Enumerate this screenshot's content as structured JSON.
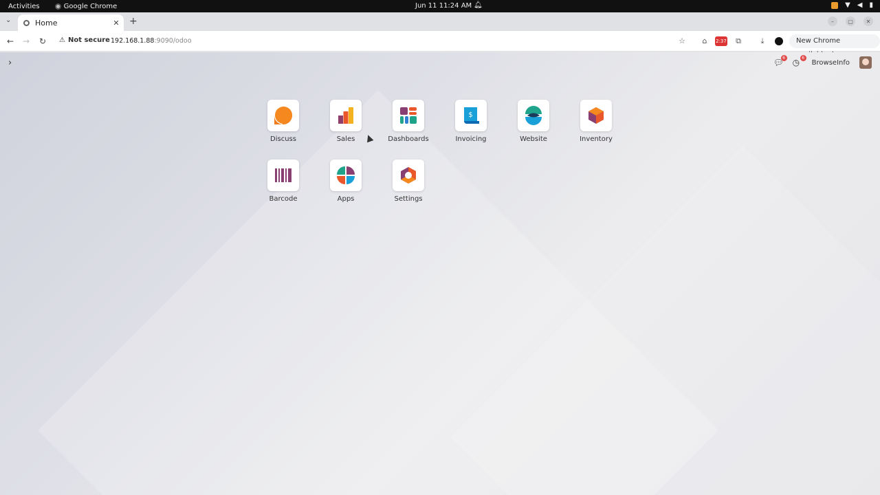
{
  "os_bar": {
    "activities": "Activities",
    "app_name": "Google Chrome",
    "clock": "Jun 11  11:24 AM"
  },
  "tab": {
    "title": "Home",
    "close_glyph": "✕",
    "new_tab_glyph": "+"
  },
  "address_bar": {
    "security_label": "Not secure",
    "url_host": "192.168.1.88",
    "url_rest": ":9090/odoo",
    "extension_badge": "2:37",
    "update_button": "New Chrome available"
  },
  "odoo": {
    "company_name": "BrowseInfo",
    "chat_badge": "6",
    "activity_badge": "6",
    "apps": [
      {
        "label": "Discuss",
        "icon": "discuss-icon"
      },
      {
        "label": "Sales",
        "icon": "sales-icon"
      },
      {
        "label": "Dashboards",
        "icon": "dashboards-icon"
      },
      {
        "label": "Invoicing",
        "icon": "invoicing-icon"
      },
      {
        "label": "Website",
        "icon": "website-icon"
      },
      {
        "label": "Inventory",
        "icon": "inventory-icon"
      },
      {
        "label": "Barcode",
        "icon": "barcode-icon"
      },
      {
        "label": "Apps",
        "icon": "apps-icon"
      },
      {
        "label": "Settings",
        "icon": "settings-icon"
      }
    ]
  }
}
